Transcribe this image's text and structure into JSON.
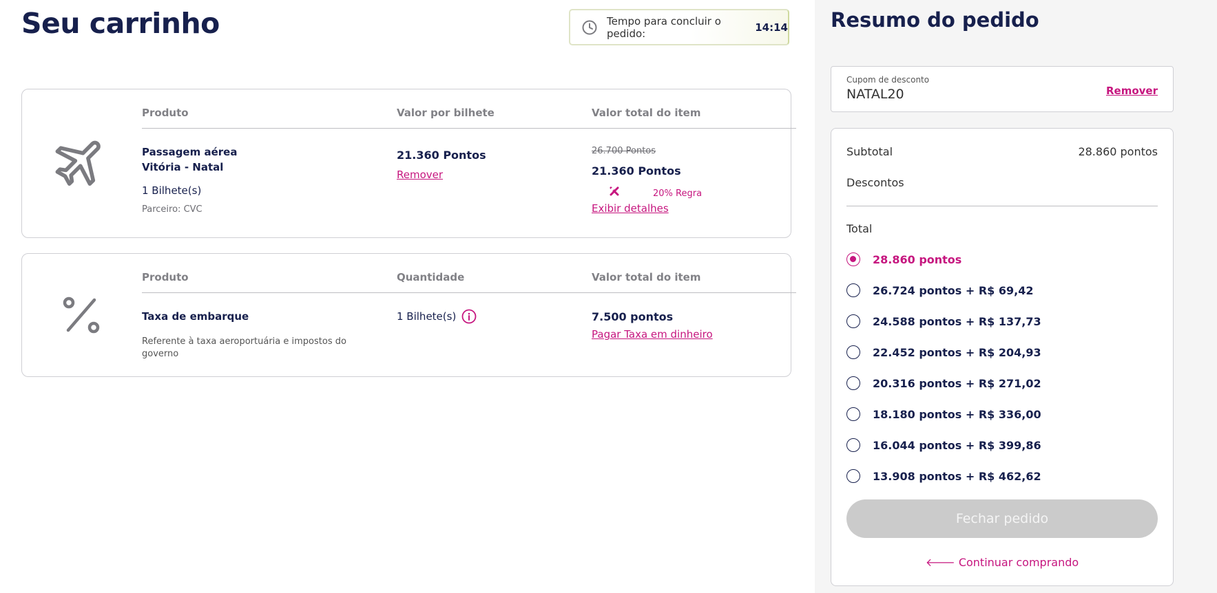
{
  "page": {
    "title": "Seu carrinho"
  },
  "timer": {
    "label": "Tempo para concluir o pedido:",
    "value": "14:14"
  },
  "flight_item": {
    "headers": {
      "product": "Produto",
      "unit_value": "Valor por bilhete",
      "total_value": "Valor total do item"
    },
    "product_name": "Passagem aérea",
    "route": "Vitória - Natal",
    "quantity": "1 Bilhete(s)",
    "partner": "Parceiro: CVC",
    "unit_price": "21.360 Pontos",
    "remove_label": "Remover",
    "old_total": "26.700 Pontos",
    "new_total": "21.360 Pontos",
    "discount_rule": "20% Regra",
    "details_label": "Exibir detalhes"
  },
  "tax_item": {
    "headers": {
      "product": "Produto",
      "quantity": "Quantidade",
      "total_value": "Valor total do item"
    },
    "product_name": "Taxa de embarque",
    "description": "Referente à taxa aeroportuária e impostos do governo",
    "quantity": "1 Bilhete(s)",
    "total": "7.500 pontos",
    "pay_cash_label": "Pagar Taxa em dinheiro"
  },
  "summary": {
    "title": "Resumo do pedido",
    "coupon": {
      "label": "Cupom de desconto",
      "value": "NATAL20",
      "remove_label": "Remover"
    },
    "subtotal_label": "Subtotal",
    "subtotal_value": "28.860 pontos",
    "discounts_label": "Descontos",
    "total_label": "Total",
    "payment_options": [
      {
        "label": "28.860 pontos",
        "selected": true
      },
      {
        "label": "26.724 pontos + R$ 69,42",
        "selected": false
      },
      {
        "label": "24.588 pontos + R$ 137,73",
        "selected": false
      },
      {
        "label": "22.452 pontos + R$ 204,93",
        "selected": false
      },
      {
        "label": "20.316 pontos + R$ 271,02",
        "selected": false
      },
      {
        "label": "18.180 pontos + R$ 336,00",
        "selected": false
      },
      {
        "label": "16.044 pontos + R$ 399,86",
        "selected": false
      },
      {
        "label": "13.908 pontos + R$ 462,62",
        "selected": false
      }
    ],
    "close_order_label": "Fechar pedido",
    "continue_label": "Continuar comprando"
  },
  "colors": {
    "accent": "#c6167f",
    "navy": "#17204d",
    "disabled": "#cbcbcb"
  }
}
